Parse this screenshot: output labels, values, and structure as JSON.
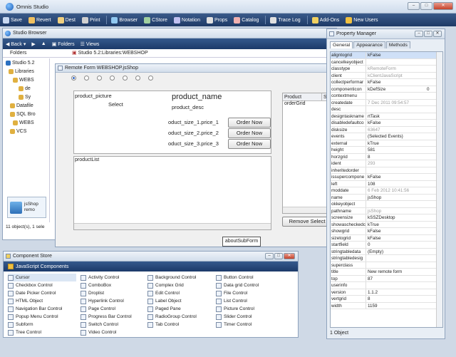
{
  "app": {
    "title": "Omnis Studio"
  },
  "toolbar": {
    "items": [
      {
        "label": "Save",
        "icon": "save-icon",
        "color": "#c8d8f0"
      },
      {
        "label": "Revert",
        "icon": "revert-icon",
        "color": "#f0c060"
      },
      {
        "label": "Dest",
        "icon": "dest-icon",
        "color": "#f0d080"
      },
      {
        "label": "Print",
        "icon": "print-icon",
        "color": "#d0d0d0"
      },
      {
        "label": "Browser",
        "icon": "browser-icon",
        "color": "#90c8f0"
      },
      {
        "label": "CStore",
        "icon": "cstore-icon",
        "color": "#a0d0a0"
      },
      {
        "label": "Notation",
        "icon": "notation-icon",
        "color": "#c0c0f0"
      },
      {
        "label": "Props",
        "icon": "props-icon",
        "color": "#e0e0e0"
      },
      {
        "label": "Catalog",
        "icon": "catalog-icon",
        "color": "#f0b0b0"
      },
      {
        "label": "Trace Log",
        "icon": "trace-log-icon",
        "color": "#e0e0e0"
      },
      {
        "label": "Add-Ons",
        "icon": "add-ons-icon",
        "color": "#f0d060"
      },
      {
        "label": "New Users",
        "icon": "new-users-icon",
        "color": "#f0c040"
      }
    ]
  },
  "browser": {
    "title": "Studio Browser",
    "nav": {
      "back": "Back",
      "folders": "Folders",
      "views": "Views"
    },
    "folders_header": "Folders",
    "path": "Studio 5.2:Libraries:WEBSHOP",
    "tree": [
      "Studio 5.2",
      "Libraries",
      "WEBS",
      "de",
      "Sy",
      "Datafile",
      "SQL Bro",
      "WEBS",
      "VCS"
    ],
    "item": {
      "name": "jsShop",
      "subtitle": "remo"
    },
    "status": "11 object(s), 1 sele"
  },
  "remote_form": {
    "title": "Remote Form WEBSHOP.jsShop",
    "product_picture": "product_picture",
    "select": "Select",
    "product_name": "product_name",
    "product_desc": "product_desc",
    "rows": [
      {
        "label": "oduct_size_1.price_1",
        "button": "Order Now"
      },
      {
        "label": "oduct_size_2.price_2",
        "button": "Order Now"
      },
      {
        "label": "oduct_size_3.price_3",
        "button": "Order Now"
      }
    ],
    "product_list": "productList",
    "grid_headers": [
      "Product",
      "S"
    ],
    "order_grid": "orderGrid",
    "remove_button": "Remove Select",
    "subform": "aboutSubForm"
  },
  "property_manager": {
    "title": "Property Manager",
    "tabs": [
      "General",
      "Appearance",
      "Methods"
    ],
    "selected_value": "kFalse",
    "rows": [
      {
        "k": "aligntogrid",
        "v": "kFalse"
      },
      {
        "k": "cancelkeyobject",
        "v": ""
      },
      {
        "k": "classtype",
        "v": "kRemoteForm",
        "dim": true
      },
      {
        "k": "client",
        "v": "kClientJavaScript",
        "dim": true
      },
      {
        "k": "collectperformar",
        "v": "kFalse"
      },
      {
        "k": "componenticon",
        "v": "kDefSize",
        "v2": "0"
      },
      {
        "k": "contextmenu",
        "v": ""
      },
      {
        "k": "createdate",
        "v": "7 Dec 2011  09:54:57",
        "dim": true
      },
      {
        "k": "desc",
        "v": ""
      },
      {
        "k": "designtaskname",
        "v": "rtTask"
      },
      {
        "k": "disabledefaultco",
        "v": "kFalse"
      },
      {
        "k": "disksize",
        "v": "63647",
        "dim": true
      },
      {
        "k": "events",
        "v": "(Selected Events)"
      },
      {
        "k": "external",
        "v": "kTrue"
      },
      {
        "k": "height",
        "v": "581"
      },
      {
        "k": "horzgrid",
        "v": "8"
      },
      {
        "k": "ident",
        "v": "293",
        "dim": true
      },
      {
        "k": "inheritedorder",
        "v": ""
      },
      {
        "k": "issupercompone",
        "v": "kFalse"
      },
      {
        "k": "left",
        "v": "108"
      },
      {
        "k": "moddate",
        "v": "6 Feb 2012  10:41:56",
        "dim": true
      },
      {
        "k": "name",
        "v": "jsShop"
      },
      {
        "k": "okkeyobject",
        "v": ""
      },
      {
        "k": "pathname",
        "v": "jsShop",
        "dim": true
      },
      {
        "k": "screensize",
        "v": "kSSZDesktop"
      },
      {
        "k": "showascheckedc",
        "v": "kTrue"
      },
      {
        "k": "showgrid",
        "v": "kFalse"
      },
      {
        "k": "sizetogrid",
        "v": "kFalse"
      },
      {
        "k": "startfield",
        "v": "0"
      },
      {
        "k": "stringtabledata",
        "v": "(Empty)"
      },
      {
        "k": "stringtabledesig",
        "v": ""
      },
      {
        "k": "superclass",
        "v": ""
      },
      {
        "k": "title",
        "v": "New remote form"
      },
      {
        "k": "top",
        "v": "87"
      },
      {
        "k": "userinfo",
        "v": ""
      },
      {
        "k": "version",
        "v": "1.1.2"
      },
      {
        "k": "vertgrid",
        "v": "8"
      },
      {
        "k": "width",
        "v": "1159"
      }
    ],
    "status": "1 Object"
  },
  "component_store": {
    "title": "Component Store",
    "category": "JavaScript Components",
    "columns": [
      [
        "Cursor",
        "Checkbox Control",
        "Date Picker Control",
        "HTML Object",
        "Navigation Bar Control",
        "Popup Menu Control",
        "Subform",
        "Tree Control"
      ],
      [
        "Activity Control",
        "ComboBox",
        "Droplist",
        "Hyperlink Control",
        "Page Control",
        "Progress Bar Control",
        "Switch Control",
        "Video Control"
      ],
      [
        "Background Control",
        "Complex Grid",
        "Edit Control",
        "Label Object",
        "Paged Pane",
        "RadioGroup Control",
        "Tab Control"
      ],
      [
        "Button Control",
        "Data grid Control",
        "File Control",
        "List Control",
        "Picture Control",
        "Slider Control",
        "Timer Control"
      ]
    ]
  }
}
